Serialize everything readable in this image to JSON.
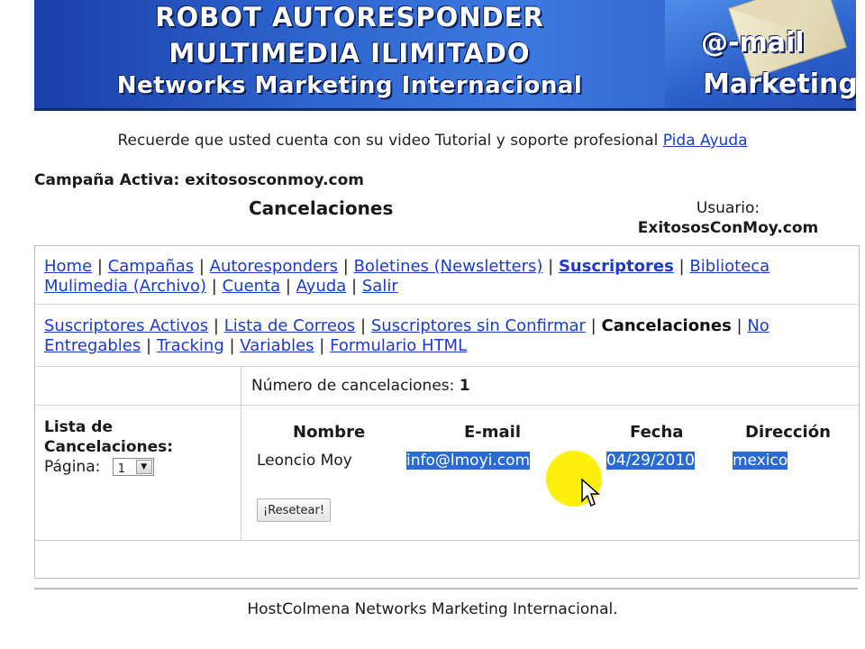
{
  "banner": {
    "line1": "ROBOT AUTORESPONDER",
    "line2": "MULTIMEDIA ILIMITADO",
    "line3": "Networks Marketing Internacional",
    "brand1": "@-mail",
    "brand2": "Marketing"
  },
  "notice": {
    "text": "Recuerde que usted cuenta con su video Tutorial y soporte profesional ",
    "link": "Pida Ayuda"
  },
  "campaign": "Campaña Activa: exitososconmoy.com",
  "section_title": "Cancelaciones",
  "user": {
    "label": "Usuario:",
    "name": "ExitososConMoy.com"
  },
  "nav_main": [
    "Home",
    "Campañas",
    "Autoresponders",
    "Boletines (Newsletters)",
    "Suscriptores",
    "Biblioteca Mulimedia (Archivo)",
    "Cuenta",
    "Ayuda",
    "Salir"
  ],
  "nav_sub": {
    "activos": "Suscriptores Activos",
    "lista": "Lista de Correos",
    "sin_confirmar": "Suscriptores sin Confirmar",
    "current": "Cancelaciones",
    "no_entregables": "No Entregables",
    "tracking": "Tracking",
    "variables": "Variables",
    "formulario": "Formulario HTML"
  },
  "count": {
    "label": "Número de cancelaciones:",
    "value": "1"
  },
  "left": {
    "title": "Lista de Cancelaciones:",
    "page_label": "Página:",
    "page_value": "1"
  },
  "table": {
    "headers": [
      "Nombre",
      "E-mail",
      "Fecha",
      "Dirección"
    ],
    "rows": [
      [
        "Leoncio Moy",
        "info@lmoyi.com",
        "04/29/2010",
        "mexico"
      ]
    ]
  },
  "reset_label": "¡Resetear!",
  "footer": "HostColmena Networks Marketing Internacional.",
  "colors": {
    "link": "#1a3cc8",
    "selection": "#2b6bd1",
    "cursor_halo": "#ffee00"
  }
}
